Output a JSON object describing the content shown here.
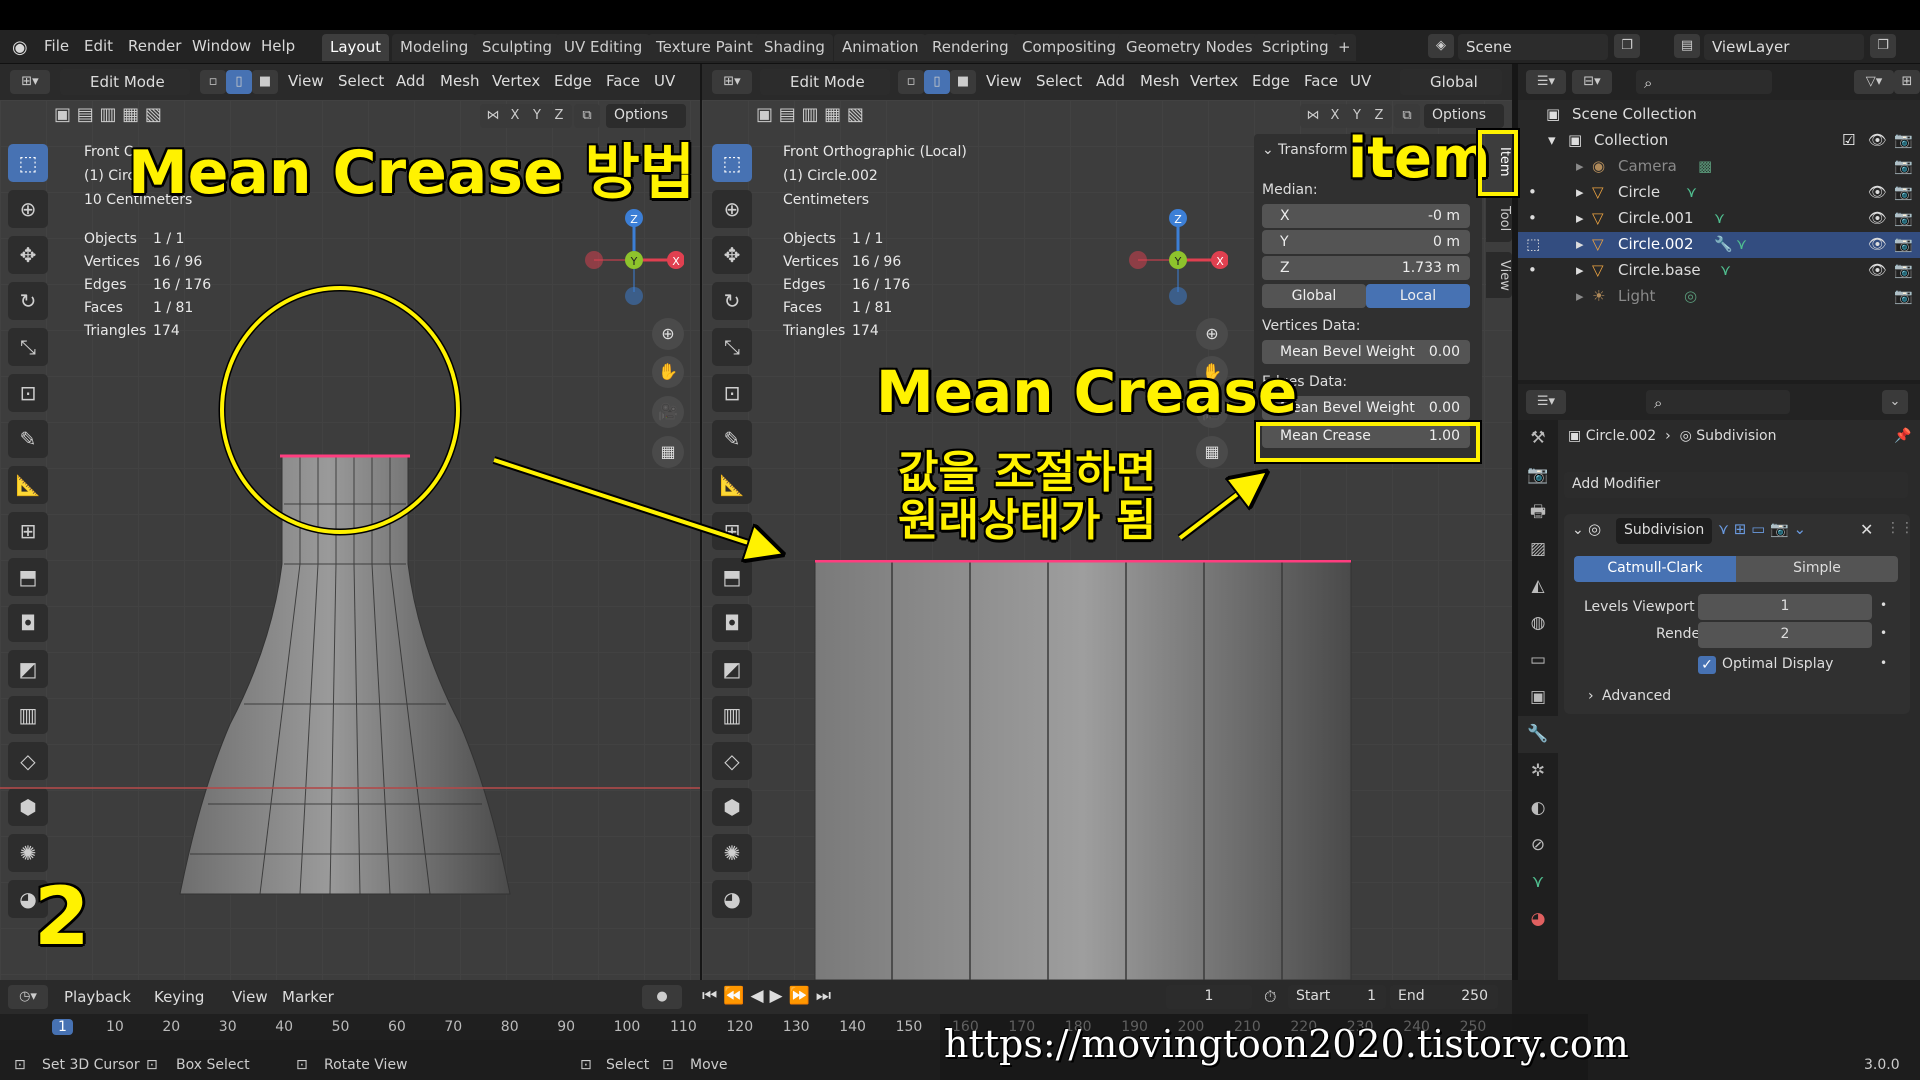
{
  "menubar": {
    "items": [
      "File",
      "Edit",
      "Render",
      "Window",
      "Help"
    ],
    "workspaces": [
      "Layout",
      "Modeling",
      "Sculpting",
      "UV Editing",
      "Texture Paint",
      "Shading",
      "Animation",
      "Rendering",
      "Compositing",
      "Geometry Nodes",
      "Scripting"
    ],
    "active_workspace": "Layout",
    "scene": "Scene",
    "view_layer": "ViewLayer"
  },
  "left_viewport": {
    "mode": "Edit Mode",
    "menus": [
      "View",
      "Select",
      "Add",
      "Mesh",
      "Vertex",
      "Edge",
      "Face",
      "UV"
    ],
    "axes": [
      "X",
      "Y",
      "Z"
    ],
    "options": "Options",
    "view_name": "Front O",
    "object_name": "(1) Circ",
    "units": "10 Centimeters",
    "stats": [
      {
        "label": "Objects",
        "value": "1 / 1"
      },
      {
        "label": "Vertices",
        "value": "16 / 96"
      },
      {
        "label": "Edges",
        "value": "16 / 176"
      },
      {
        "label": "Faces",
        "value": "1 / 81"
      },
      {
        "label": "Triangles",
        "value": "174"
      }
    ]
  },
  "right_viewport": {
    "mode": "Edit Mode",
    "menus": [
      "View",
      "Select",
      "Add",
      "Mesh",
      "Vertex",
      "Edge",
      "Face",
      "UV"
    ],
    "axes": [
      "X",
      "Y",
      "Z"
    ],
    "options": "Options",
    "orientation": "Global",
    "view_name": "Front Orthographic (Local)",
    "object_name": "(1) Circle.002",
    "units": "Centimeters",
    "stats": [
      {
        "label": "Objects",
        "value": "1 / 1"
      },
      {
        "label": "Vertices",
        "value": "16 / 96"
      },
      {
        "label": "Edges",
        "value": "16 / 176"
      },
      {
        "label": "Faces",
        "value": "1 / 81"
      },
      {
        "label": "Triangles",
        "value": "174"
      }
    ]
  },
  "gizmo": {
    "x": "X",
    "y": "Y",
    "z": "Z"
  },
  "npanel": {
    "header": "Transform",
    "median": "Median:",
    "x_label": "X",
    "x_value": "-0 m",
    "y_label": "Y",
    "y_value": "0 m",
    "z_label": "Z",
    "z_value": "1.733 m",
    "global": "Global",
    "local": "Local",
    "vertices_data": "Vertices Data:",
    "v_bevel_label": "Mean Bevel Weight",
    "v_bevel_value": "0.00",
    "edges_data": "Edges Data:",
    "e_bevel_label": "Mean Bevel Weight",
    "e_bevel_value": "0.00",
    "crease_label": "Mean Crease",
    "crease_value": "1.00",
    "tabs": [
      "Item",
      "Tool",
      "View"
    ]
  },
  "outliner": {
    "title": "Scene Collection",
    "collection": "Collection",
    "items": [
      "Camera",
      "Circle",
      "Circle.001",
      "Circle.002",
      "Circle.base",
      "Light"
    ]
  },
  "properties": {
    "breadcrumb_obj": "Circle.002",
    "breadcrumb_mod": "Subdivision",
    "add_modifier": "Add Modifier",
    "modifier_name": "Subdivision",
    "catmull": "Catmull-Clark",
    "simple": "Simple",
    "levels_label": "Levels Viewport",
    "levels_value": "1",
    "render_label": "Render",
    "render_value": "2",
    "optimal": "Optimal Display",
    "advanced": "Advanced"
  },
  "timeline": {
    "playback": "Playback",
    "keying": "Keying",
    "view": "View",
    "marker": "Marker",
    "current_frame": "1",
    "start_label": "Start",
    "start_value": "1",
    "end_label": "End",
    "end_value": "250",
    "ruler": [
      "1",
      "10",
      "20",
      "30",
      "40",
      "50",
      "60",
      "70",
      "80",
      "90",
      "100",
      "110",
      "120",
      "130",
      "140",
      "150",
      "160",
      "170",
      "180",
      "190",
      "200",
      "210",
      "220",
      "230",
      "240",
      "250"
    ]
  },
  "statusbar": {
    "cursor": "Set 3D Cursor",
    "box": "Box Select",
    "rotate": "Rotate View",
    "select": "Select",
    "move": "Move",
    "version": "3.0.0"
  },
  "annotations": {
    "title": "Mean Crease  방법",
    "item": "item",
    "center_title": "Mean Crease",
    "line1": "값을 조절하면",
    "line2": "원래상태가 됨",
    "number": "2",
    "watermark": "https://movingtoon2020.tistory.com"
  },
  "colors": {
    "accent": "#4772b3",
    "annotation": "#fff200",
    "edge_selected": "#ff3d7f"
  }
}
